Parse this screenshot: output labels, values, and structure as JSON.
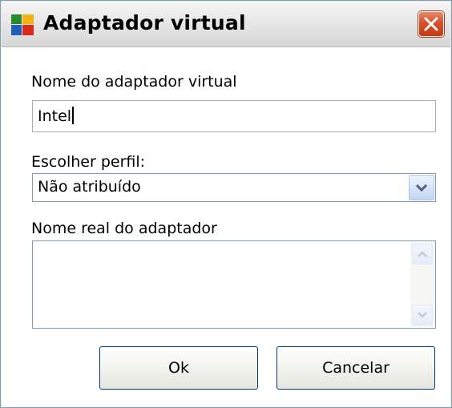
{
  "window": {
    "title": "Adaptador virtual",
    "close_label": "Close"
  },
  "form": {
    "virtual_name_label": "Nome do adaptador virtual",
    "virtual_name_value": "Intel",
    "profile_label": "Escolher perfil:",
    "profile_selected": "Não atribuído",
    "real_name_label": "Nome real do adaptador",
    "real_name_value": ""
  },
  "buttons": {
    "ok": "Ok",
    "cancel": "Cancelar"
  },
  "icons": {
    "app_logo": "avg-logo-icon",
    "close": "close-icon",
    "dropdown": "chevron-down-icon",
    "scroll_up": "scroll-up-arrow-icon",
    "scroll_down": "scroll-down-arrow-icon"
  },
  "colors": {
    "close_button": "#d9502a",
    "window_border": "#7f9db9",
    "button_border": "#003c74"
  }
}
